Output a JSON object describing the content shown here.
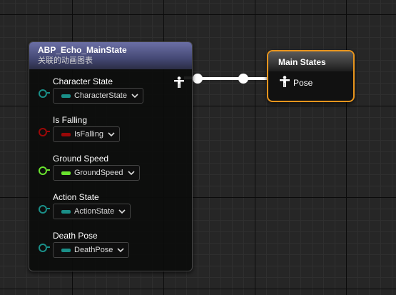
{
  "state_node": {
    "title": "ABP_Echo_MainState",
    "subtitle": "关联的动画图表",
    "pins": [
      {
        "label": "Character State",
        "value": "CharacterState",
        "color": "#1a8f88"
      },
      {
        "label": "Is Falling",
        "value": "IsFalling",
        "color": "#9b0808"
      },
      {
        "label": "Ground Speed",
        "value": "GroundSpeed",
        "color": "#6ae42f"
      },
      {
        "label": "Action State",
        "value": "ActionState",
        "color": "#1a8f88"
      },
      {
        "label": "Death Pose",
        "value": "DeathPose",
        "color": "#1a8f88"
      }
    ],
    "output_icon": "pose-person-icon"
  },
  "main_states": {
    "title": "Main States",
    "input_label": "Pose",
    "input_icon": "pose-person-icon",
    "border_color": "#e8951d"
  },
  "wire_color": "#ffffff"
}
